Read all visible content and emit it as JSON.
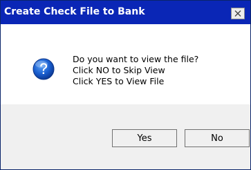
{
  "dialog": {
    "title": "Create Check File to Bank",
    "close_glyph": "✕",
    "icon": "question-icon",
    "message_lines": [
      "Do you want to view the file?",
      "Click NO to Skip View",
      "Click YES to View File"
    ],
    "buttons": {
      "yes_label": "Yes",
      "no_label": "No"
    }
  },
  "colors": {
    "titlebar": "#0a26b6",
    "title_text": "#ffffff",
    "icon_blue": "#1a5fd0",
    "footer_bg": "#f0f0f0"
  }
}
